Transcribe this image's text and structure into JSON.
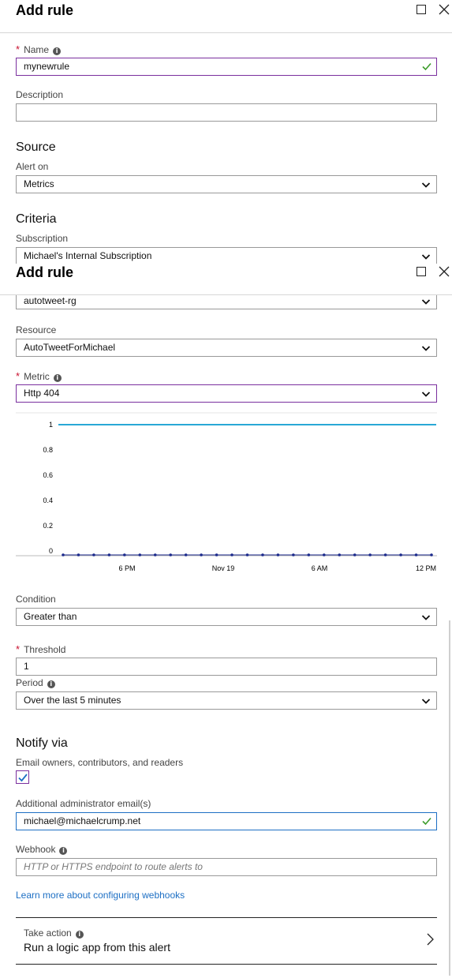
{
  "blade1": {
    "title": "Add rule",
    "name_label": "Name",
    "name_value": "mynewrule",
    "description_label": "Description",
    "description_value": "",
    "source_heading": "Source",
    "alert_on_label": "Alert on",
    "alert_on_value": "Metrics",
    "criteria_heading": "Criteria",
    "subscription_label": "Subscription",
    "subscription_value": "Michael's Internal Subscription"
  },
  "blade2": {
    "title": "Add rule",
    "resource_group_value": "autotweet-rg",
    "resource_label": "Resource",
    "resource_value": "AutoTweetForMichael",
    "metric_label": "Metric",
    "metric_value": "Http 404"
  },
  "chart_data": {
    "type": "line",
    "title": "",
    "xlabel": "",
    "ylabel": "",
    "ylim": [
      0,
      1
    ],
    "y_ticks": [
      "1",
      "0.8",
      "0.6",
      "0.4",
      "0.2",
      "0"
    ],
    "x_ticks": [
      "6 PM",
      "Nov 19",
      "6 AM",
      "12 PM"
    ],
    "series": [
      {
        "color": "#29a8d6",
        "values": [
          1,
          1
        ]
      },
      {
        "color": "#1b2a8c",
        "values": [
          0,
          0,
          0,
          0,
          0,
          0,
          0,
          0,
          0,
          0,
          0,
          0,
          0,
          0,
          0,
          0,
          0,
          0,
          0,
          0,
          0,
          0,
          0,
          0,
          0
        ]
      }
    ]
  },
  "condition": {
    "label": "Condition",
    "value": "Greater than"
  },
  "threshold": {
    "label": "Threshold",
    "value": "1"
  },
  "period": {
    "label": "Period",
    "value": "Over the last 5 minutes"
  },
  "notify": {
    "heading": "Notify via",
    "email_owners_label": "Email owners, contributors, and readers",
    "email_owners_checked": true,
    "admin_email_label": "Additional administrator email(s)",
    "admin_email_value": "michael@michaelcrump.net",
    "webhook_label": "Webhook",
    "webhook_placeholder": "HTTP or HTTPS endpoint to route alerts to",
    "learn_more": "Learn more about configuring webhooks"
  },
  "take_action": {
    "label": "Take action",
    "value": "Run a logic app from this alert"
  },
  "colors": {
    "focus_border": "#7a2f9e",
    "valid_check": "#3c9c2b",
    "link": "#1d6fc4",
    "required": "#c8102e"
  },
  "icons": [
    "maximize-icon",
    "close-icon",
    "info-icon",
    "chevron-down-icon",
    "checkmark-icon",
    "chevron-right-icon"
  ]
}
